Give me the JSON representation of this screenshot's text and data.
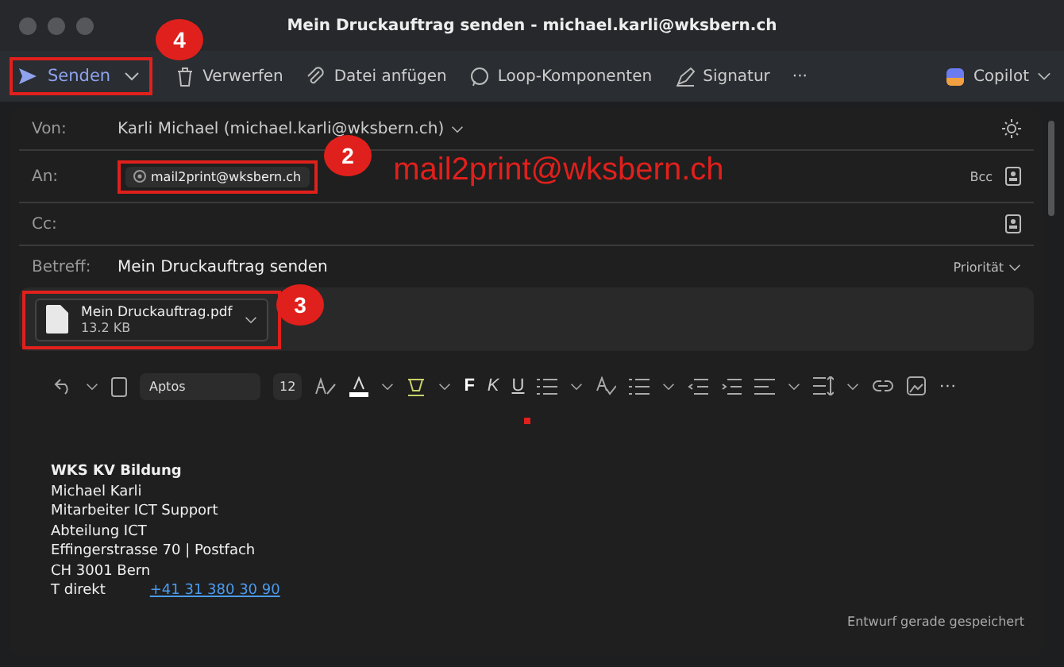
{
  "window": {
    "title": "Mein Druckauftrag senden - michael.karli@wksbern.ch"
  },
  "toolbar": {
    "send": "Senden",
    "items": [
      {
        "kind": "trash",
        "label": "Verwerfen"
      },
      {
        "kind": "clip",
        "label": "Datei anfügen"
      },
      {
        "kind": "loop",
        "label": "Loop-Komponenten"
      },
      {
        "kind": "pen",
        "label": "Signatur"
      }
    ],
    "more": "···",
    "copilot": "Copilot"
  },
  "fields": {
    "from_label": "Von:",
    "from": "Karli Michael (michael.karli@wksbern.ch)",
    "to_label": "An:",
    "to": "mail2print@wksbern.ch",
    "bcc": "Bcc",
    "cc_label": "Cc:",
    "subject_label": "Betreff:",
    "subject": "Mein Druckauftrag senden",
    "priority": "Priorität"
  },
  "attachment": {
    "name": "Mein Druckauftrag.pdf",
    "size": "13.2 KB"
  },
  "format": {
    "font": "Aptos",
    "size": "12",
    "bold": "F",
    "italic": "K",
    "underline": "U"
  },
  "body": {
    "lines": [
      "WKS KV Bildung",
      "Michael Karli",
      "Mitarbeiter ICT Support",
      "Abteilung ICT",
      "Effingerstrasse 70 | Postfach",
      "CH 3001 Bern"
    ],
    "phone_label": "T direkt",
    "phone": "+41 31 380 30 90"
  },
  "status": "Entwurf gerade gespeichert",
  "annotations": {
    "note": "mail2print@wksbern.ch",
    "callouts": [
      "4",
      "2",
      "3"
    ]
  }
}
